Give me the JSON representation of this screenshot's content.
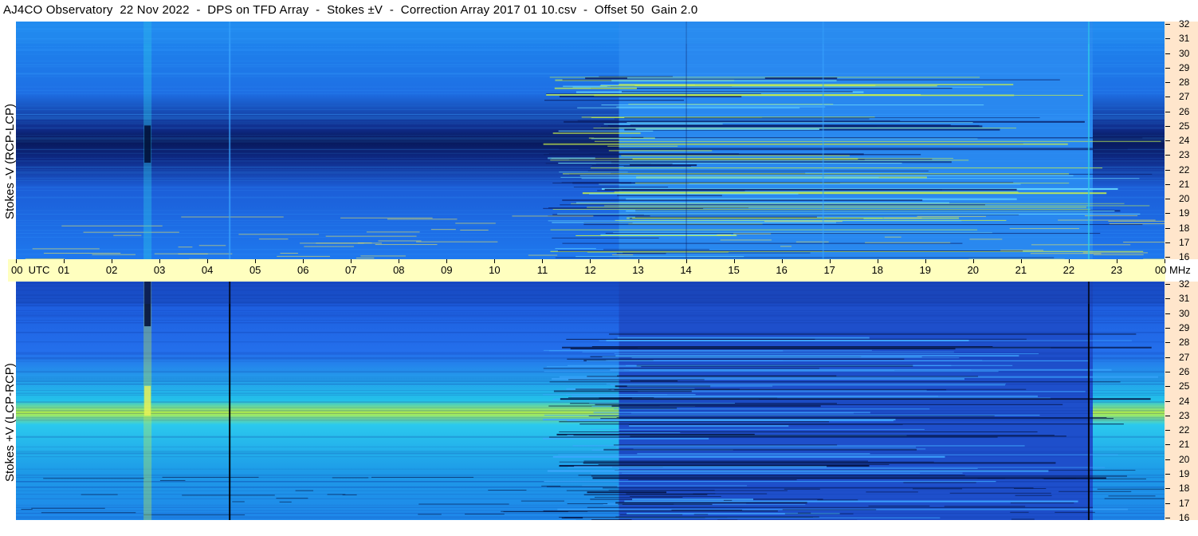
{
  "title": "AJ4CO Observatory  22 Nov 2022  -  DPS on TFD Array  -  Stokes ±V  -  Correction Array 2017 01 10.csv  -  Offset 50  Gain 2.0",
  "panels": {
    "top_label": "Stokes -V (RCP-LCP)",
    "bottom_label": "Stokes +V (LCP-RCP)"
  },
  "time_axis": {
    "labels": [
      "00  UTC",
      "01",
      "02",
      "03",
      "04",
      "05",
      "06",
      "07",
      "08",
      "09",
      "10",
      "11",
      "12",
      "13",
      "14",
      "15",
      "16",
      "17",
      "18",
      "19",
      "20",
      "21",
      "22",
      "23",
      "00 MHz"
    ]
  },
  "freq_axis": {
    "labels": [
      "32",
      "31",
      "30",
      "29",
      "28",
      "27",
      "26",
      "25",
      "24",
      "23",
      "22",
      "21",
      "20",
      "19",
      "18",
      "17",
      "16"
    ]
  },
  "colors": {
    "axis_bg": "#ffffbf",
    "freq_bg": "#ffe6cc",
    "bg_blue": "#1e64e6",
    "dark": "#0a1e66",
    "bright": "#c8f03c"
  },
  "chart_data": {
    "type": "heatmap",
    "title": "AJ4CO Observatory  22 Nov 2022  -  DPS on TFD Array  -  Stokes ±V  -  Correction Array 2017 01 10.csv  -  Offset 50  Gain 2.0",
    "xlabel": "UTC",
    "ylabel": "MHz",
    "xlim": [
      0,
      24
    ],
    "ylim": [
      16,
      32
    ],
    "x_ticks": [
      0,
      1,
      2,
      3,
      4,
      5,
      6,
      7,
      8,
      9,
      10,
      11,
      12,
      13,
      14,
      15,
      16,
      17,
      18,
      19,
      20,
      21,
      22,
      23,
      24
    ],
    "y_ticks": [
      16,
      17,
      18,
      19,
      20,
      21,
      22,
      23,
      24,
      25,
      26,
      27,
      28,
      29,
      30,
      31,
      32
    ],
    "series": [
      {
        "name": "Stokes -V (RCP-LCP)",
        "features": [
          {
            "kind": "band",
            "freq_center": 23.8,
            "width": 2.0,
            "t_start": 0,
            "t_end": 12.6,
            "level": "dark"
          },
          {
            "kind": "band",
            "freq_center": 23.8,
            "width": 2.0,
            "t_start": 22.5,
            "t_end": 24,
            "level": "dark"
          },
          {
            "kind": "vertical",
            "time": 2.75,
            "level": "dark"
          },
          {
            "kind": "rfi_region",
            "t_start": 12.6,
            "t_end": 22.5,
            "freq_low": 16,
            "freq_high": 28,
            "level": "bright"
          }
        ]
      },
      {
        "name": "Stokes +V (LCP-RCP)",
        "features": [
          {
            "kind": "band",
            "freq_center": 23.8,
            "width": 2.0,
            "t_start": 0,
            "t_end": 12.6,
            "level": "bright"
          },
          {
            "kind": "band",
            "freq_center": 23.8,
            "width": 2.0,
            "t_start": 22.5,
            "t_end": 24,
            "level": "bright"
          },
          {
            "kind": "vertical",
            "time": 4.45,
            "level": "black"
          },
          {
            "kind": "vertical",
            "time": 22.4,
            "level": "black"
          },
          {
            "kind": "rfi_region",
            "t_start": 12.6,
            "t_end": 22.5,
            "freq_low": 16,
            "freq_high": 28,
            "level": "dark"
          }
        ]
      }
    ]
  }
}
